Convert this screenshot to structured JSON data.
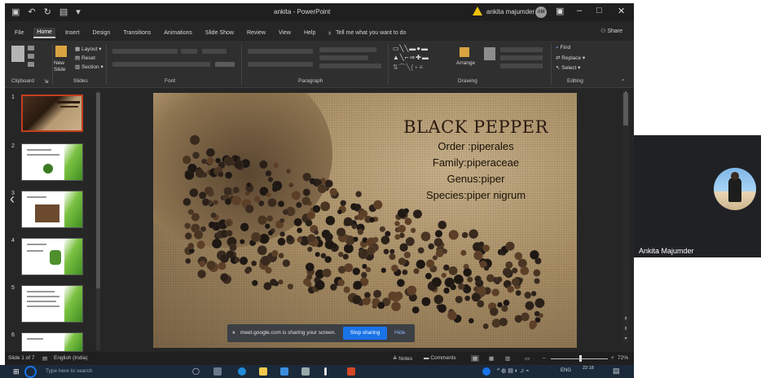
{
  "window": {
    "title": "ankita - PowerPoint",
    "user_name": "ankita majumder",
    "user_initials": "AM",
    "warning_color": "#f2c00b"
  },
  "tabs": [
    "File",
    "Home",
    "Insert",
    "Design",
    "Transitions",
    "Animations",
    "Slide Show",
    "Review",
    "View",
    "Help"
  ],
  "active_tab": "Home",
  "tell_me": "Tell me what you want to do",
  "share_label": "Share",
  "ribbon": {
    "groups": [
      "Clipboard",
      "Slides",
      "Font",
      "Paragraph",
      "Drawing",
      "Editing"
    ],
    "slides": {
      "new_slide": "New Slide",
      "layout": "Layout",
      "reset": "Reset",
      "section": "Section"
    },
    "drawing": {
      "arrange": "Arrange"
    },
    "editing": {
      "find": "Find",
      "replace": "Replace",
      "select": "Select"
    }
  },
  "thumbnails": [
    "1",
    "2",
    "3",
    "4",
    "5",
    "6"
  ],
  "slide": {
    "title": "BLACK PEPPER",
    "lines": [
      "Order :piperales",
      "Family:piperaceae",
      "Genus:piper",
      "Species:piper nigrum"
    ]
  },
  "screen_share": {
    "message": "meet.google.com is sharing your screen.",
    "stop_label": "Stop sharing",
    "hide_label": "Hide",
    "stop_color": "#1a73e8"
  },
  "statusbar": {
    "slide_count": "Slide 1 of 7",
    "language": "English (India)",
    "notes": "Notes",
    "comments": "Comments",
    "zoom": "72%"
  },
  "taskbar": {
    "search_placeholder": "Type here to search",
    "language": "ENG",
    "time": "22:18"
  },
  "meet": {
    "participant_name": "Ankita Majumder"
  }
}
